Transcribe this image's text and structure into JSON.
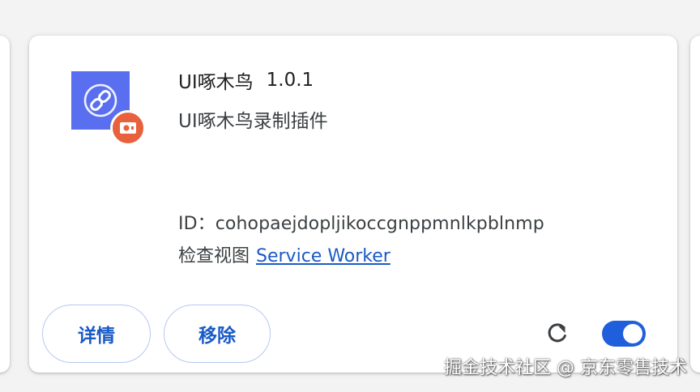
{
  "extension": {
    "name": "UI啄木鸟",
    "version": "1.0.1",
    "description": "UI啄木鸟录制插件",
    "id_label": "ID：",
    "id_value": "cohopaejdopljikoccgnppmnlkpblnmp",
    "inspect_views_label": "检查视图",
    "inspect_views_link": "Service Worker",
    "icon": "link-icon",
    "badge_icon": "record-icon",
    "enabled": true
  },
  "actions": {
    "details_label": "详情",
    "remove_label": "移除",
    "reload_icon": "reload-icon",
    "toggle_state": "on"
  },
  "watermark": "掘金技术社区 @ 京东零售技术",
  "colors": {
    "accent": "#1a5ac6",
    "toggle": "#1f5fdc",
    "icon_bg": "#5a6ff0",
    "badge_bg": "#e8603c",
    "button_border": "#b6c8f0"
  }
}
